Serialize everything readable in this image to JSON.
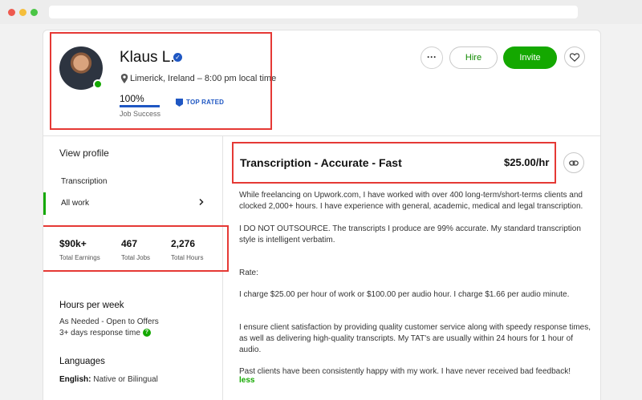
{
  "profile": {
    "name": "Klaus L.",
    "location": "Limerick, Ireland – 8:00 pm local time",
    "job_success_value": "100%",
    "job_success_label": "Job Success",
    "top_rated_label": "TOP RATED"
  },
  "actions": {
    "more_label": "···",
    "hire_label": "Hire",
    "invite_label": "Invite"
  },
  "sidebar": {
    "view_profile": "View profile",
    "items": [
      {
        "label": "Transcription"
      },
      {
        "label": "All work"
      }
    ]
  },
  "stats": [
    {
      "value": "$90k+",
      "label": "Total Earnings"
    },
    {
      "value": "467",
      "label": "Total Jobs"
    },
    {
      "value": "2,276",
      "label": "Total Hours"
    }
  ],
  "hours": {
    "title": "Hours per week",
    "line1": "As Needed - Open to Offers",
    "line2": "3+ days response time"
  },
  "languages": {
    "title": "Languages",
    "language": "English:",
    "level": "Native or Bilingual"
  },
  "main": {
    "title": "Transcription - Accurate - Fast",
    "rate": "$25.00/hr",
    "paragraphs": [
      "While freelancing on Upwork.com, I have worked with over 400 long-term/short-terms clients and clocked 2,000+ hours. I have experience with general, academic, medical and legal transcription.",
      "I DO NOT OUTSOURCE. The transcripts I produce are 99% accurate. My standard transcription style is intelligent verbatim.",
      "Rate:",
      "I charge $25.00 per hour of work or $100.00 per audio hour. I charge $1.66 per audio minute.",
      "I ensure client satisfaction by providing quality customer service along with speedy response times, as well as delivering high-quality transcripts. My TAT's are usually within 24 hours for 1 hour of audio.",
      "Past clients have been consistently happy with my work. I have never received bad feedback!"
    ],
    "less_label": "less"
  },
  "colors": {
    "accent_green": "#14a800",
    "brand_blue": "#1f57c3",
    "highlight_red": "#e53935"
  },
  "icons": [
    "verified-badge-icon",
    "location-pin-icon",
    "top-rated-badge-icon",
    "more-options-icon",
    "heart-icon",
    "chevron-right-icon",
    "question-icon",
    "link-icon"
  ]
}
